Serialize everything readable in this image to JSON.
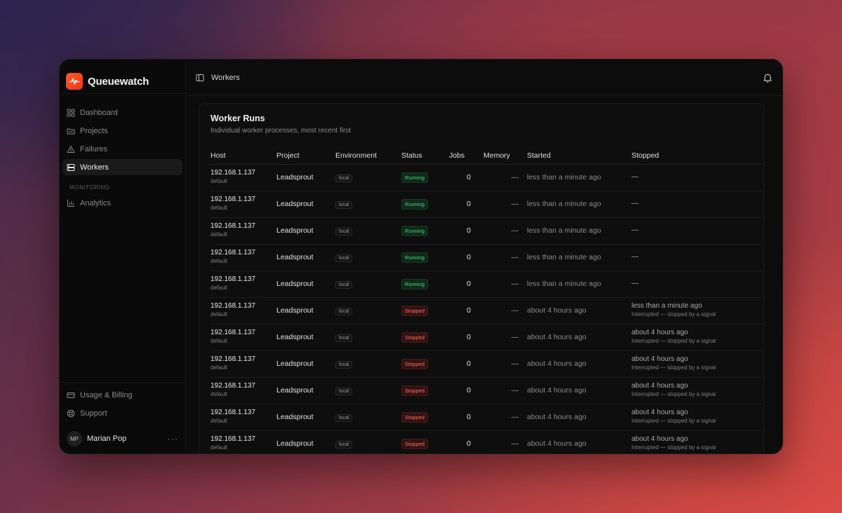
{
  "brand": {
    "name": "Queuewatch",
    "accent": "#ff4a22"
  },
  "sidebar": {
    "items": [
      {
        "label": "Dashboard",
        "icon": "grid-icon",
        "active": false
      },
      {
        "label": "Projects",
        "icon": "folder-icon",
        "active": false
      },
      {
        "label": "Failures",
        "icon": "warning-icon",
        "active": false
      },
      {
        "label": "Workers",
        "icon": "server-icon",
        "active": true
      }
    ],
    "section_label": "Monitoring",
    "section_items": [
      {
        "label": "Analytics",
        "icon": "bar-chart-icon"
      }
    ],
    "bottom_items": [
      {
        "label": "Usage & Billing",
        "icon": "credit-card-icon"
      },
      {
        "label": "Support",
        "icon": "life-buoy-icon"
      }
    ],
    "user": {
      "initials": "MP",
      "name": "Marian Pop",
      "more": "···"
    }
  },
  "topbar": {
    "title": "Workers"
  },
  "card": {
    "title": "Worker Runs",
    "subtitle": "Individual worker processes, most recent first",
    "columns": [
      "Host",
      "Project",
      "Environment",
      "Status",
      "Jobs",
      "Memory",
      "Started",
      "Stopped"
    ],
    "rows": [
      {
        "host": "192.168.1.137",
        "queue": "default",
        "project": "Leadsprout",
        "env": "local",
        "status": "Running",
        "jobs": "0",
        "memory": "—",
        "started": "less than a minute ago",
        "stopped": "—",
        "reason": ""
      },
      {
        "host": "192.168.1.137",
        "queue": "default",
        "project": "Leadsprout",
        "env": "local",
        "status": "Running",
        "jobs": "0",
        "memory": "—",
        "started": "less than a minute ago",
        "stopped": "—",
        "reason": ""
      },
      {
        "host": "192.168.1.137",
        "queue": "default",
        "project": "Leadsprout",
        "env": "local",
        "status": "Running",
        "jobs": "0",
        "memory": "—",
        "started": "less than a minute ago",
        "stopped": "—",
        "reason": ""
      },
      {
        "host": "192.168.1.137",
        "queue": "default",
        "project": "Leadsprout",
        "env": "local",
        "status": "Running",
        "jobs": "0",
        "memory": "—",
        "started": "less than a minute ago",
        "stopped": "—",
        "reason": ""
      },
      {
        "host": "192.168.1.137",
        "queue": "default",
        "project": "Leadsprout",
        "env": "local",
        "status": "Running",
        "jobs": "0",
        "memory": "—",
        "started": "less than a minute ago",
        "stopped": "—",
        "reason": ""
      },
      {
        "host": "192.168.1.137",
        "queue": "default",
        "project": "Leadsprout",
        "env": "local",
        "status": "Stopped",
        "jobs": "0",
        "memory": "—",
        "started": "about 4 hours ago",
        "stopped": "less than a minute ago",
        "reason": "Interrupted — stopped by a signal"
      },
      {
        "host": "192.168.1.137",
        "queue": "default",
        "project": "Leadsprout",
        "env": "local",
        "status": "Stopped",
        "jobs": "0",
        "memory": "—",
        "started": "about 4 hours ago",
        "stopped": "about 4 hours ago",
        "reason": "Interrupted — stopped by a signal"
      },
      {
        "host": "192.168.1.137",
        "queue": "default",
        "project": "Leadsprout",
        "env": "local",
        "status": "Stopped",
        "jobs": "0",
        "memory": "—",
        "started": "about 4 hours ago",
        "stopped": "about 4 hours ago",
        "reason": "Interrupted — stopped by a signal"
      },
      {
        "host": "192.168.1.137",
        "queue": "default",
        "project": "Leadsprout",
        "env": "local",
        "status": "Stopped",
        "jobs": "0",
        "memory": "—",
        "started": "about 4 hours ago",
        "stopped": "about 4 hours ago",
        "reason": "Interrupted — stopped by a signal"
      },
      {
        "host": "192.168.1.137",
        "queue": "default",
        "project": "Leadsprout",
        "env": "local",
        "status": "Stopped",
        "jobs": "0",
        "memory": "—",
        "started": "about 4 hours ago",
        "stopped": "about 4 hours ago",
        "reason": "Interrupted — stopped by a signal"
      },
      {
        "host": "192.168.1.137",
        "queue": "default",
        "project": "Leadsprout",
        "env": "local",
        "status": "Stopped",
        "jobs": "0",
        "memory": "—",
        "started": "about 4 hours ago",
        "stopped": "about 4 hours ago",
        "reason": "Interrupted — stopped by a signal"
      }
    ]
  },
  "colors": {
    "running": "#4fd27a",
    "stopped": "#ff6a5e"
  }
}
